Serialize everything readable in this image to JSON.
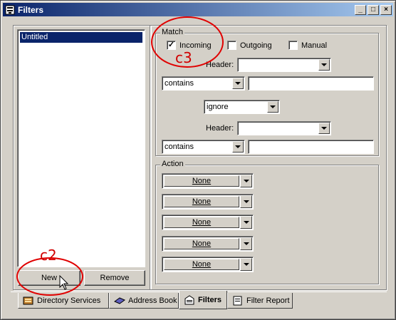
{
  "window": {
    "title": "Filters"
  },
  "titlebar_buttons": {
    "minimize": "_",
    "maximize": "□",
    "close": "×"
  },
  "filter_list": {
    "items": [
      "Untitled"
    ]
  },
  "buttons": {
    "new": "New",
    "remove": "Remove"
  },
  "match": {
    "group_label": "Match",
    "incoming": {
      "label": "Incoming",
      "checked": true,
      "mark": "✓"
    },
    "outgoing": {
      "label": "Outgoing",
      "checked": false
    },
    "manual": {
      "label": "Manual",
      "checked": false
    },
    "header1_label": "Header:",
    "header1_value": "",
    "condition1": "contains",
    "value1": "",
    "operator": "ignore",
    "header2_label": "Header:",
    "header2_value": "",
    "condition2": "contains",
    "value2": ""
  },
  "action": {
    "group_label": "Action",
    "items": [
      "None",
      "None",
      "None",
      "None",
      "None"
    ]
  },
  "tabs": [
    {
      "label": "Directory Services",
      "icon": "directory-services-icon"
    },
    {
      "label": "Address Book",
      "icon": "address-book-icon"
    },
    {
      "label": "Filters",
      "icon": "filters-icon",
      "active": true
    },
    {
      "label": "Filter Report",
      "icon": "filter-report-icon"
    }
  ],
  "annotations": {
    "c3": "c3",
    "c2": "c2"
  },
  "colors": {
    "titlebar": "#0a246a",
    "selection": "#0a246a",
    "annotation": "#e00000",
    "face": "#d4d0c8"
  }
}
